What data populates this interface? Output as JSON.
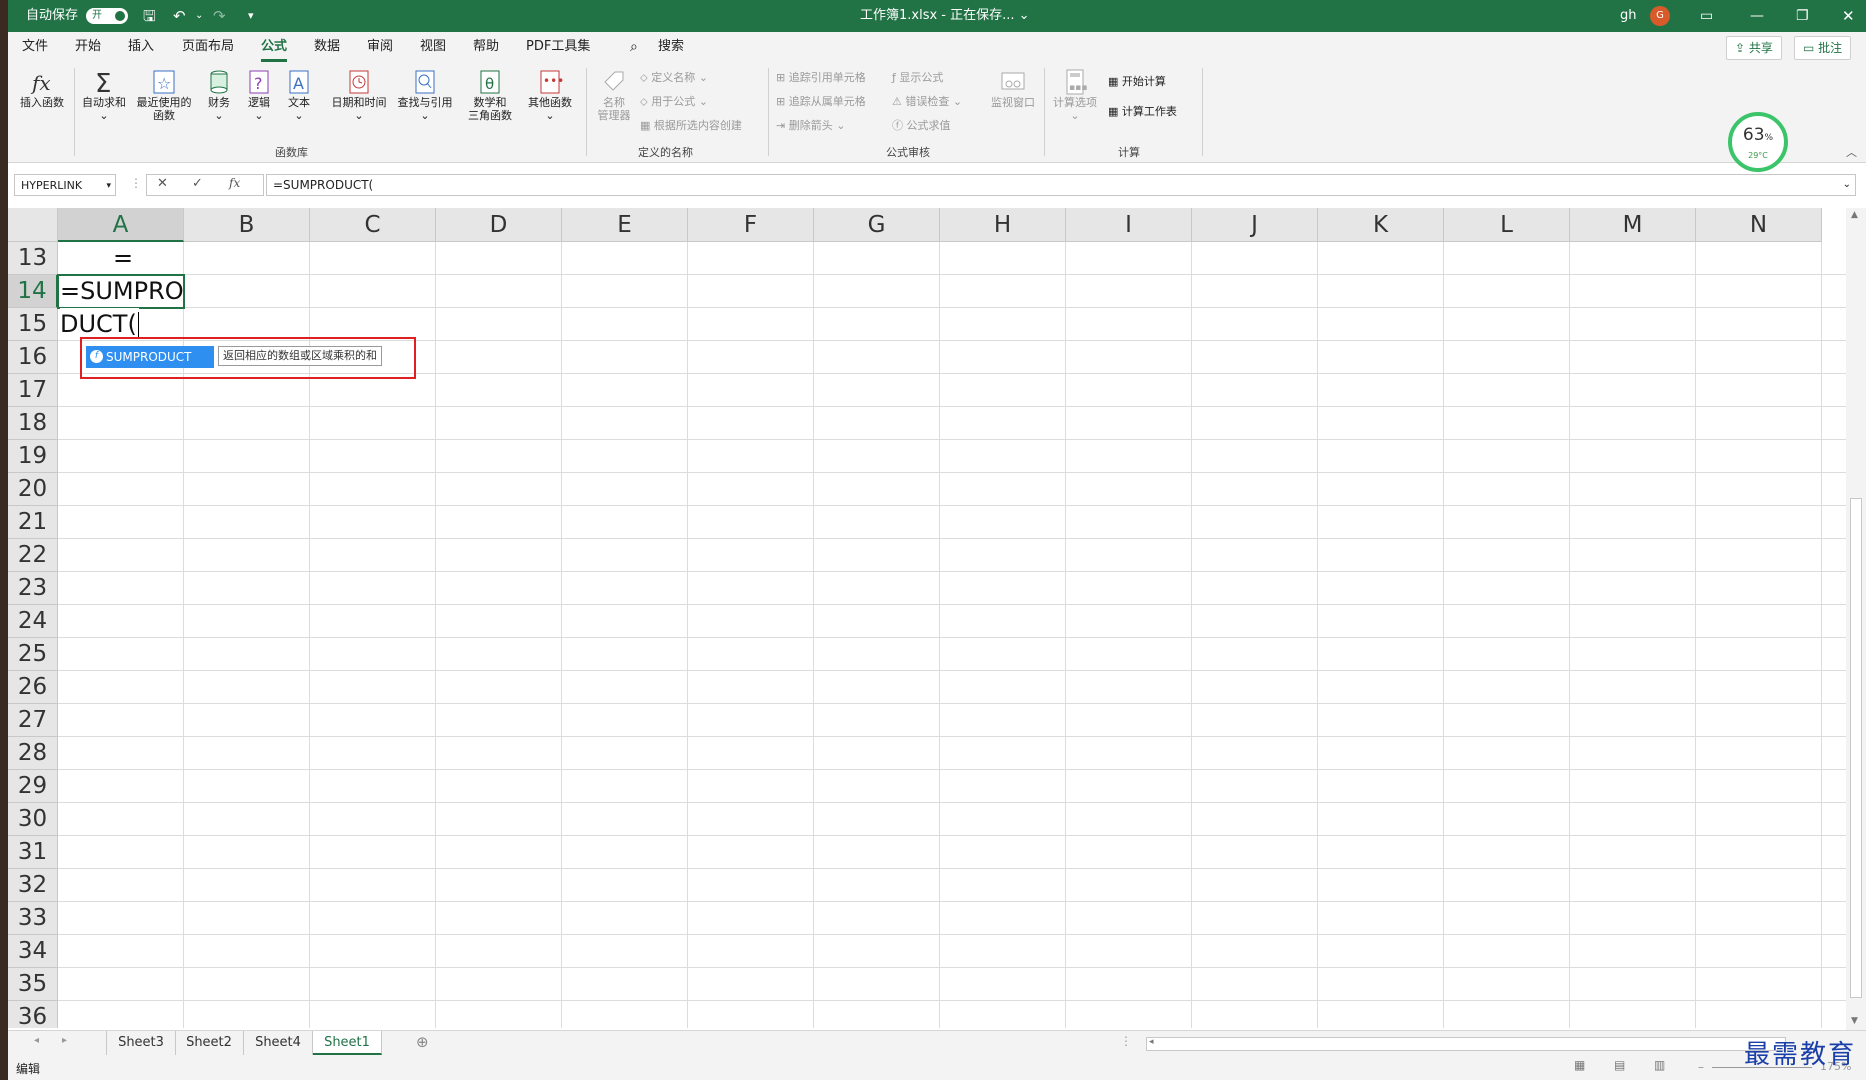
{
  "titlebar": {
    "autosave_label": "自动保存",
    "autosave_state": "开",
    "doc_title": "工作簿1.xlsx - 正在保存... ⌄",
    "user": "gh",
    "avatar_letter": "G",
    "accent": "#217346"
  },
  "menu": {
    "tabs": [
      "文件",
      "开始",
      "插入",
      "页面布局",
      "公式",
      "数据",
      "审阅",
      "视图",
      "帮助",
      "PDF工具集"
    ],
    "active": "公式",
    "search": "搜索",
    "share": "共享",
    "comment": "批注"
  },
  "ribbon": {
    "insert_function": "插入函数",
    "autosum": "自动求和",
    "recent": [
      "最近使用的",
      "函数"
    ],
    "financial": "财务",
    "logical": "逻辑",
    "text": "文本",
    "datetime": "日期和时间",
    "lookup": "查找与引用",
    "math": [
      "数学和",
      "三角函数"
    ],
    "more": "其他函数",
    "group_function_library": "函数库",
    "name_manager": [
      "名称",
      "管理器"
    ],
    "define_name": "定义名称",
    "use_in_formula": "用于公式",
    "create_from_selection": "根据所选内容创建",
    "group_defined_names": "定义的名称",
    "trace_precedents": "追踪引用单元格",
    "trace_dependents": "追踪从属单元格",
    "remove_arrows": "删除箭头",
    "show_formulas": "显示公式",
    "error_checking": "错误检查",
    "evaluate_formula": "公式求值",
    "watch_window": "监视窗口",
    "group_formula_auditing": "公式审核",
    "calc_options": "计算选项",
    "calc_now": "开始计算",
    "calc_sheet": "计算工作表",
    "group_calculation": "计算"
  },
  "gauge": {
    "percent": "63",
    "unit": "%",
    "temp": "29°C"
  },
  "formula_bar": {
    "name_box": "HYPERLINK",
    "cancel": "✕",
    "enter": "✓",
    "fx": "fx",
    "formula": "=SUMPRODUCT("
  },
  "grid": {
    "columns": [
      "A",
      "B",
      "C",
      "D",
      "E",
      "F",
      "G",
      "H",
      "I",
      "J",
      "K",
      "L",
      "M",
      "N"
    ],
    "rows": [
      "13",
      "14",
      "15",
      "16",
      "17",
      "18",
      "19",
      "20",
      "21",
      "22",
      "23",
      "24",
      "25",
      "26",
      "27",
      "28",
      "29",
      "30",
      "31",
      "32",
      "33",
      "34",
      "35",
      "36"
    ],
    "selected_col": "A",
    "selected_row": "14",
    "cell_a13": "=",
    "cell_a14_line1": "=SUMPRO",
    "cell_a14_line2": "DUCT("
  },
  "autocomplete": {
    "item": "SUMPRODUCT",
    "tip": "返回相应的数组或区域乘积的和",
    "highlight_color": "#e02020",
    "selected_color": "#2f8ff0"
  },
  "sheets": {
    "tabs": [
      "Sheet3",
      "Sheet2",
      "Sheet4",
      "Sheet1"
    ],
    "active": "Sheet1"
  },
  "status": {
    "mode": "编辑",
    "zoom": "175%"
  },
  "watermark": "最需教育"
}
